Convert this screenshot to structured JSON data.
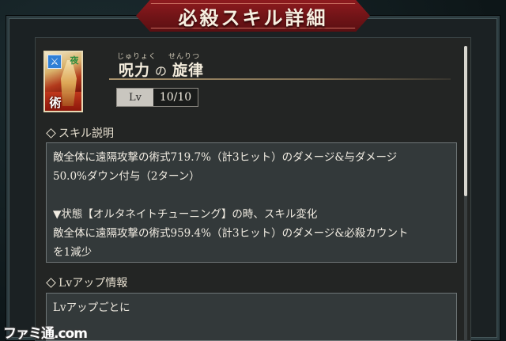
{
  "header": {
    "title": "必殺スキル詳細"
  },
  "skill": {
    "ruby_left": "じゅりょく",
    "ruby_right": "せんりつ",
    "name_part1": "呪力",
    "name_particle": "の",
    "name_part2": "旋律",
    "level_label": "Lv",
    "level_value": "10/10",
    "icon": {
      "attribute_badge": "sword-icon",
      "corner_kanji": "夜",
      "type_kanji": "術"
    }
  },
  "sections": {
    "description": {
      "heading": "スキル説明",
      "lines": [
        "敵全体に遠隔攻撃の術式719.7%（計3ヒット）のダメージ&与ダメージ",
        "50.0%ダウン付与（2ターン）",
        "",
        "▼状態【オルタネイトチューニング】の時、スキル変化",
        "敵全体に遠隔攻撃の術式959.4%（計3ヒット）のダメージ&必殺カウント",
        "を1減少"
      ]
    },
    "levelup": {
      "heading": "Lvアップ情報",
      "lines": [
        "Lvアップごとに"
      ]
    }
  },
  "watermark": {
    "text": "ファミ通.com"
  },
  "colors": {
    "header_red": "#8e1a1e",
    "panel_bg": "#232524",
    "box_bg": "#33393a",
    "text": "#f1ece2"
  }
}
